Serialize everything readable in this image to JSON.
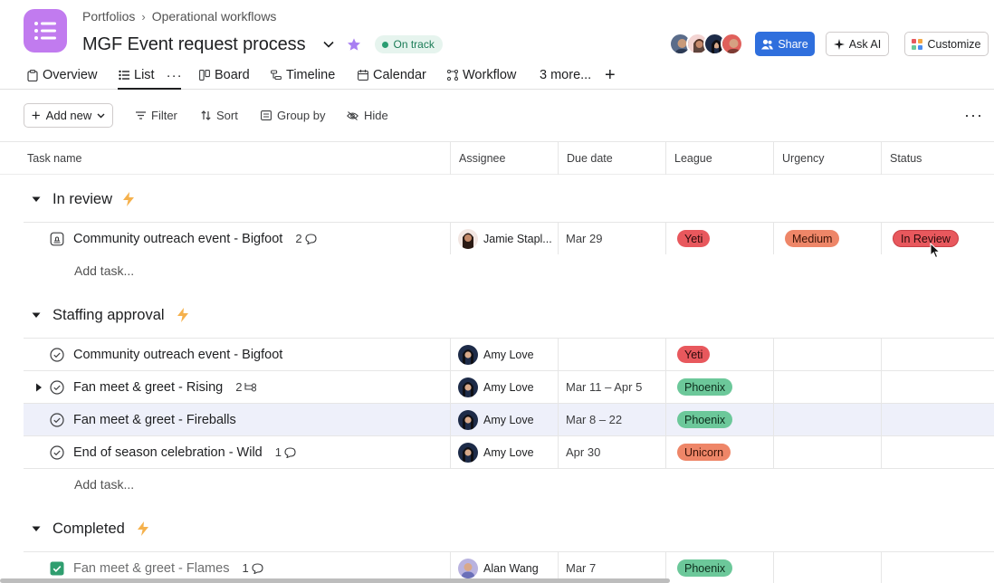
{
  "breadcrumb": {
    "parent": "Portfolios",
    "current": "Operational workflows"
  },
  "header": {
    "title": "MGF Event request process",
    "status": "On track"
  },
  "buttons": {
    "share": "Share",
    "ask_ai": "Ask AI",
    "customize": "Customize"
  },
  "tabs": [
    {
      "label": "Overview",
      "icon": "clipboard-icon"
    },
    {
      "label": "List",
      "icon": "list-icon",
      "active": true
    },
    {
      "label": "Board",
      "icon": "board-icon"
    },
    {
      "label": "Timeline",
      "icon": "timeline-icon"
    },
    {
      "label": "Calendar",
      "icon": "calendar-icon"
    },
    {
      "label": "Workflow",
      "icon": "workflow-icon"
    },
    {
      "label": "3 more...",
      "icon": null
    }
  ],
  "toolbar": {
    "add_new": "Add new",
    "filter": "Filter",
    "sort": "Sort",
    "group_by": "Group by",
    "hide": "Hide"
  },
  "columns": {
    "task": "Task name",
    "assignee": "Assignee",
    "due": "Due date",
    "league": "League",
    "urgency": "Urgency",
    "status": "Status"
  },
  "add_task_label": "Add task...",
  "sections": [
    {
      "title": "In review",
      "tasks": [
        {
          "name": "Community outreach event - Bigfoot",
          "meta": "2",
          "meta_icon": "comment-icon",
          "assignee": "Jamie Stapl...",
          "due": "Mar 29",
          "league": "Yeti",
          "urgency": "Medium",
          "status": "In Review"
        }
      ]
    },
    {
      "title": "Staffing approval",
      "tasks": [
        {
          "name": "Community outreach event - Bigfoot",
          "meta": "",
          "assignee": "Amy Love",
          "due": "",
          "league": "Yeti"
        },
        {
          "name": "Fan meet & greet - Rising",
          "meta": "2",
          "meta_icon": "subtask-icon",
          "assignee": "Amy Love",
          "due": "Mar 11 – Apr 5",
          "league": "Phoenix"
        },
        {
          "name": "Fan meet & greet - Fireballs",
          "meta": "",
          "assignee": "Amy Love",
          "due": "Mar 8 – 22",
          "league": "Phoenix"
        },
        {
          "name": "End of season celebration - Wild",
          "meta": "1",
          "meta_icon": "comment-icon",
          "assignee": "Amy Love",
          "due": "Apr 30",
          "league": "Unicorn"
        }
      ]
    },
    {
      "title": "Completed",
      "tasks": [
        {
          "name": "Fan meet & greet - Flames",
          "meta": "1",
          "meta_icon": "comment-icon",
          "assignee": "Alan Wang",
          "due": "Mar 7",
          "league": "Phoenix"
        }
      ]
    }
  ],
  "colors": {
    "accent": "#2f6fdd",
    "app_icon": "#c17bef",
    "on_track": "#2a9d72",
    "yeti": "#e8585d",
    "phoenix": "#6cc89a",
    "unicorn": "#ee8668"
  }
}
